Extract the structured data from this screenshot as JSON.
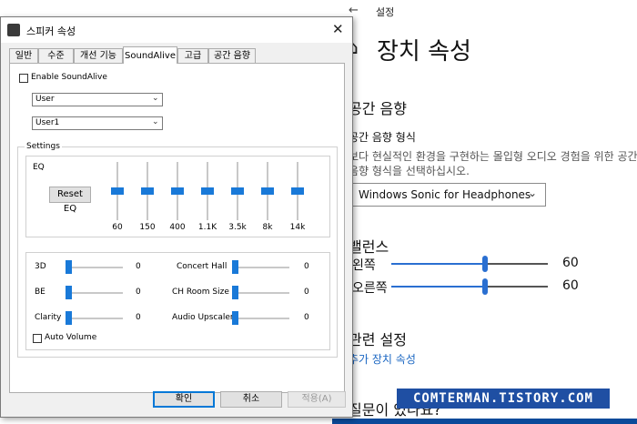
{
  "settings": {
    "app_title": "설정",
    "page_title": "장치 속성",
    "spatial_heading": "공간 음향",
    "spatial_format_label": "공간 음향 형식",
    "spatial_description": "보다 현실적인 환경을 구현하는 몰입형 오디오 경험을 위한 공간 음향 형식을 선택하십시오.",
    "spatial_format_value": "Windows Sonic for Headphones",
    "balance_heading": "밸런스",
    "left_label": "왼쪽",
    "left_value": "60",
    "left_level": 0.6,
    "right_label": "오른쪽",
    "right_value": "60",
    "right_level": 0.6,
    "related_heading": "관련 설정",
    "related_link": "추가 장치 속성",
    "question": "질문이 있나요?"
  },
  "watermark": "COMTERMAN.TISTORY.COM",
  "dialog": {
    "title": "스피커 속성",
    "tabs": [
      "일반",
      "수준",
      "개선 기능",
      "SoundAlive",
      "고급",
      "공간 음향"
    ],
    "active_tab": "SoundAlive",
    "enable_label": "Enable SoundAlive",
    "combo1_value": "User",
    "combo2_value": "User1",
    "settings_group": "Settings",
    "eq_label": "EQ",
    "reset_eq_label": "Reset EQ",
    "eq_bands": [
      "60",
      "150",
      "400",
      "1.1K",
      "3.5k",
      "8k",
      "14k"
    ],
    "effects_left": [
      {
        "label": "3D",
        "value": "0"
      },
      {
        "label": "BE",
        "value": "0"
      },
      {
        "label": "Clarity",
        "value": "0"
      }
    ],
    "effects_right": [
      {
        "label": "Concert Hall",
        "value": "0"
      },
      {
        "label": "CH Room Size",
        "value": "0"
      },
      {
        "label": "Audio Upscaler",
        "value": "0"
      }
    ],
    "auto_volume_label": "Auto Volume",
    "ok_label": "확인",
    "cancel_label": "취소",
    "apply_label": "적용(A)"
  },
  "colors": {
    "accent": "#1979d8",
    "link": "#1a66c2",
    "watermark_bg": "#1f4fa3"
  }
}
